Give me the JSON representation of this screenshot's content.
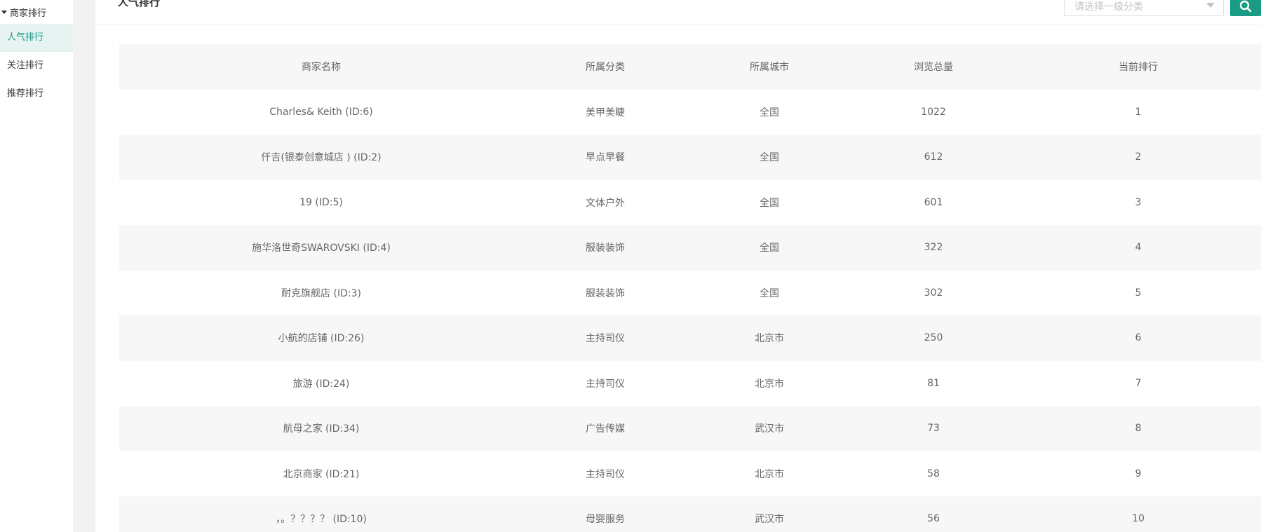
{
  "sidebar": {
    "group_label": "商家排行",
    "items": [
      {
        "label": "人气排行",
        "active": true
      },
      {
        "label": "关注排行",
        "active": false
      },
      {
        "label": "推荐排行",
        "active": false
      }
    ]
  },
  "header": {
    "title": "人气排行",
    "select_placeholder": "请选择一级分类"
  },
  "table": {
    "columns": [
      "商家名称",
      "所属分类",
      "所属城市",
      "浏览总量",
      "当前排行"
    ],
    "rows": [
      [
        "Charles& Keith (ID:6)",
        "美甲美睫",
        "全国",
        "1022",
        "1"
      ],
      [
        "仟吉(银泰创意城店 ) (ID:2)",
        "早点早餐",
        "全国",
        "612",
        "2"
      ],
      [
        "19 (ID:5)",
        "文体户外",
        "全国",
        "601",
        "3"
      ],
      [
        "施华洛世奇SWAROVSKI (ID:4)",
        "服装装饰",
        "全国",
        "322",
        "4"
      ],
      [
        "耐克旗舰店 (ID:3)",
        "服装装饰",
        "全国",
        "302",
        "5"
      ],
      [
        "小航的店铺 (ID:26)",
        "主持司仪",
        "北京市",
        "250",
        "6"
      ],
      [
        "旅游 (ID:24)",
        "主持司仪",
        "北京市",
        "81",
        "7"
      ],
      [
        "航母之家 (ID:34)",
        "广告传媒",
        "武汉市",
        "73",
        "8"
      ],
      [
        "北京商家 (ID:21)",
        "主持司仪",
        "北京市",
        "58",
        "9"
      ],
      [
        "，。？？？？ (ID:10)",
        "母婴服务",
        "武汉市",
        "56",
        "10"
      ]
    ]
  },
  "colors": {
    "accent": "#1a9b85",
    "active_bg": "#e6f3f1",
    "stripe": "#f7f7f7",
    "gutter": "#f2f2f2"
  }
}
